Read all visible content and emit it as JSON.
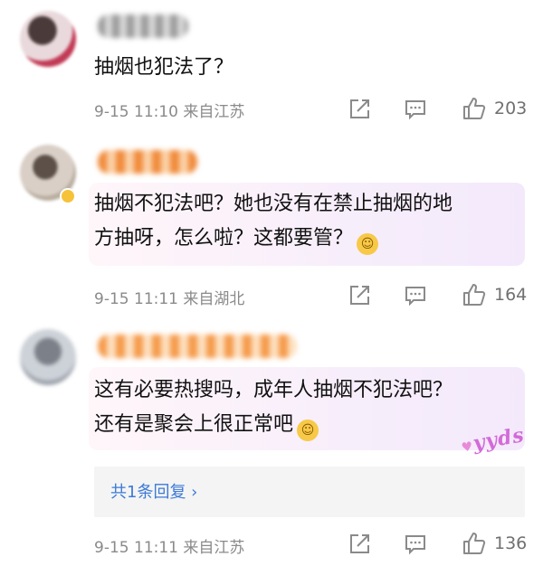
{
  "comments": [
    {
      "text_lines": [
        "抽烟也犯法了？"
      ],
      "date": "9-15",
      "time": "11:10",
      "location": "来自江苏",
      "likes": "203"
    },
    {
      "text_lines": [
        "抽烟不犯法吧？她也没有在禁止抽烟的地",
        "方抽呀，怎么啦？这都要管？"
      ],
      "date": "9-15",
      "time": "11:11",
      "location": "来自湖北",
      "likes": "164"
    },
    {
      "text_lines": [
        "这有必要热搜吗，成年人抽烟不犯法吧？",
        "还有是聚会上很正常吧"
      ],
      "date": "9-15",
      "time": "11:11",
      "location": "来自江苏",
      "likes": "136",
      "badge": "yyds",
      "reply_link": "共1条回复 ›"
    }
  ],
  "icons": {
    "share": "share-icon",
    "comment": "comment-icon",
    "like": "thumbs-up-icon"
  },
  "colors": {
    "link": "#3d7ad6",
    "meta": "#8a8a8a",
    "bubble": "#f7eefb"
  }
}
